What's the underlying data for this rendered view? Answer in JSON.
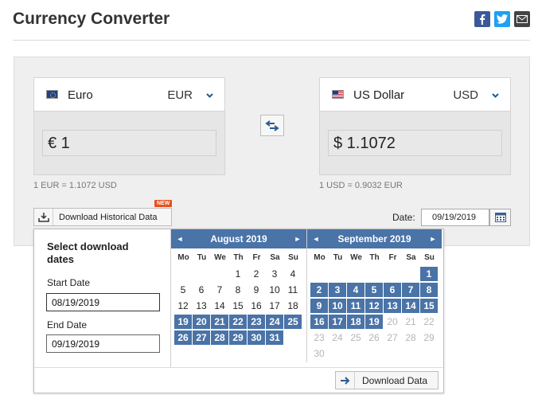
{
  "header": {
    "title": "Currency Converter",
    "social": [
      "facebook-icon",
      "twitter-icon",
      "email-icon"
    ]
  },
  "from": {
    "name": "Euro",
    "code": "EUR",
    "amount": "€ 1",
    "rate_note": "1 EUR = 1.1072 USD"
  },
  "to": {
    "name": "US Dollar",
    "code": "USD",
    "amount": "$ 1.1072",
    "rate_note": "1 USD = 0.9032 EUR"
  },
  "historical": {
    "button_label": "Download Historical Data",
    "badge": "NEW",
    "date_label": "Date:",
    "date_value": "09/19/2019"
  },
  "download_panel": {
    "title": "Select download dates",
    "start_label": "Start Date",
    "start_value": "08/19/2019",
    "end_label": "End Date",
    "end_value": "09/19/2019",
    "button_label": "Download Data"
  },
  "calendar": {
    "prev": "◄",
    "next": "►",
    "weekdays": [
      "Mo",
      "Tu",
      "We",
      "Th",
      "Fr",
      "Sa",
      "Su"
    ],
    "months": [
      {
        "title": "August 2019",
        "lead_blanks": 3,
        "days": 31,
        "selected_from": 19,
        "selected_to": 31,
        "disabled_from": 32
      },
      {
        "title": "September 2019",
        "lead_blanks": 6,
        "days": 30,
        "selected_from": 1,
        "selected_to": 19,
        "disabled_from": 20
      }
    ]
  },
  "colors": {
    "accent": "#4a73a7",
    "badge": "#e8501e",
    "panel_bg": "#efefef"
  }
}
